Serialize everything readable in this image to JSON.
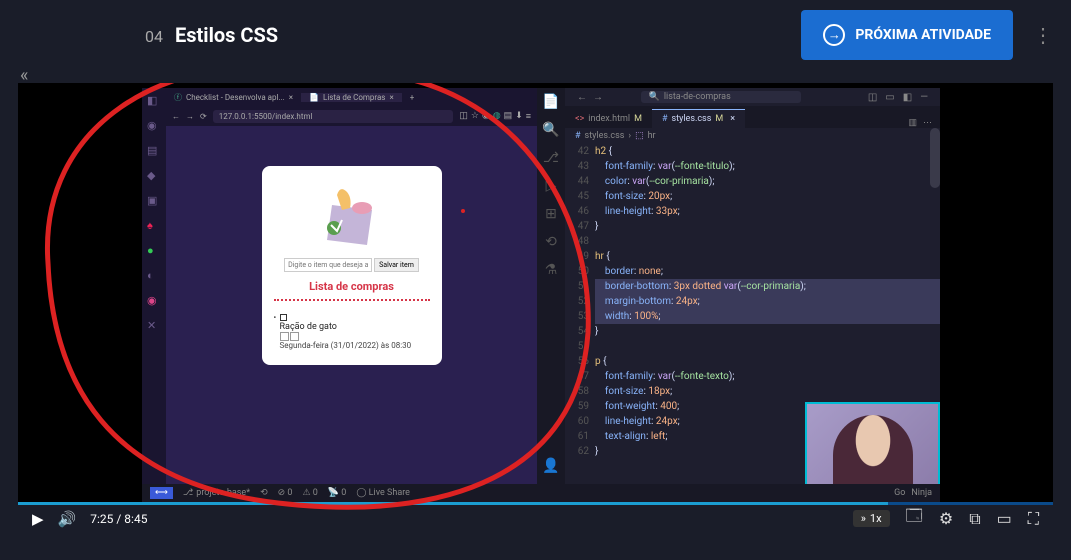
{
  "topbar": {
    "lesson_number": "04",
    "lesson_name": "Estilos CSS",
    "next_button": "PRÓXIMA ATIVIDADE"
  },
  "browser": {
    "tab1": "Checklist - Desenvolva apl...",
    "tab2": "Lista de Compras",
    "url": "127.0.0.1:5500/index.html"
  },
  "card": {
    "placeholder": "Digite o item que deseja adic",
    "save": "Salvar item",
    "heading": "Lista de compras",
    "item_name": "Ração de gato",
    "item_date": "Segunda-feira (31/01/2022) às 08:30"
  },
  "editor": {
    "search": "lista-de-compras",
    "tab1": "index.html",
    "tab2": "styles.css",
    "mod": "M",
    "breadcrumb_file": "styles.css",
    "breadcrumb_sel": "hr",
    "lines": [
      "42",
      "43",
      "44",
      "45",
      "46",
      "47",
      "48",
      "49",
      "50",
      "51",
      "52",
      "53",
      "54",
      "55",
      "56",
      "57",
      "58",
      "59",
      "60",
      "61",
      "62"
    ]
  },
  "code": {
    "h2": "h2",
    "hr": "hr",
    "p": "p",
    "ff": "font-family",
    "col": "color",
    "fs": "font-size",
    "lh": "line-height",
    "bd": "border",
    "bb": "border-bottom",
    "mb": "margin-bottom",
    "w": "width",
    "fw": "font-weight",
    "ta": "text-align",
    "var": "var",
    "ft": "--fonte-titulo",
    "cp": "--cor-primaria",
    "fx": "--fonte-texto",
    "v20": "20px",
    "v33": "33px",
    "none": "none",
    "v3": "3px",
    "dotted": "dotted",
    "v24": "24px",
    "v100": "100%",
    "v18": "18px",
    "v400": "400",
    "left": "left"
  },
  "statusbar": {
    "branch": "projeto-base*",
    "errors": "0",
    "warnings": "0",
    "ports": "0",
    "live": "Live Share",
    "go": "Go",
    "ninja": "Ninja"
  },
  "player": {
    "current": "7:25",
    "sep": "/",
    "total": "8:45",
    "speed": "1x"
  }
}
